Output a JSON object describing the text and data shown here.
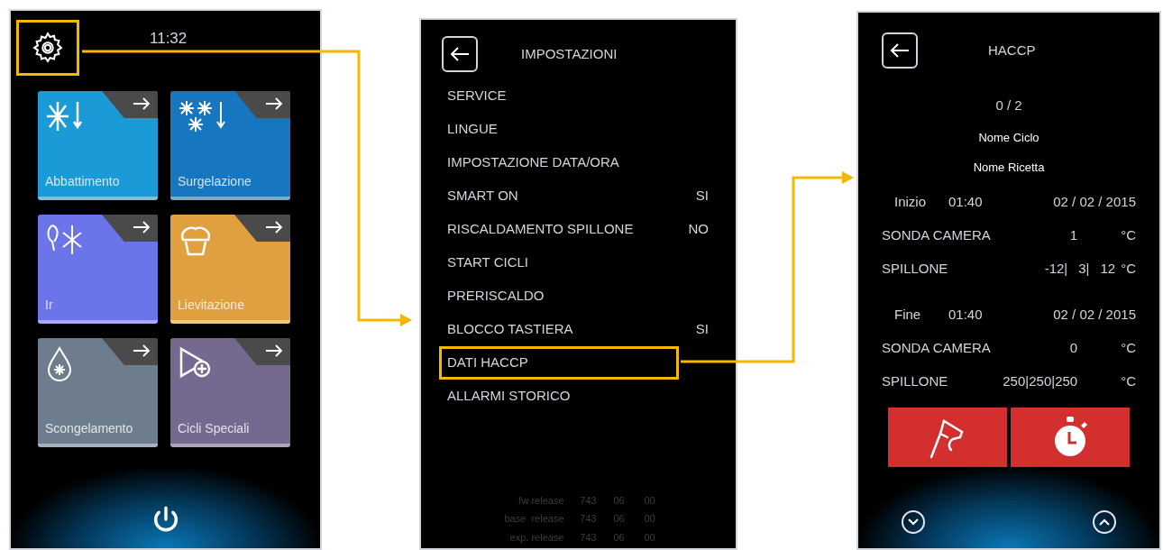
{
  "home": {
    "time": "11:32",
    "tiles": [
      {
        "label": "Abbattimento",
        "kind": "blast",
        "color": "#1a9ad6"
      },
      {
        "label": "Surgelazione",
        "kind": "freeze",
        "color": "#1676c0"
      },
      {
        "label": "Ir",
        "kind": "ir",
        "color": "#6b74e8"
      },
      {
        "label": "Lievitazione",
        "kind": "proof",
        "color": "#e0a040"
      },
      {
        "label": "Scongelamento",
        "kind": "thaw",
        "color": "#6e7d8e"
      },
      {
        "label": "Cicli Speciali",
        "kind": "special",
        "color": "#75698f"
      }
    ]
  },
  "settings": {
    "title": "IMPOSTAZIONI",
    "items": [
      {
        "label": "SERVICE",
        "selected": false
      },
      {
        "label": "LINGUE",
        "selected": false
      },
      {
        "label": "IMPOSTAZIONE DATA/ORA",
        "selected": false
      },
      {
        "label": "SMART ON",
        "value": "SI",
        "selected": false
      },
      {
        "label": "RISCALDAMENTO SPILLONE",
        "value": "NO",
        "selected": false
      },
      {
        "label": "START CICLI",
        "selected": false
      },
      {
        "label": "PRERISCALDO",
        "selected": false
      },
      {
        "label": "BLOCCO TASTIERA",
        "value": "SI",
        "selected": false
      },
      {
        "label": "DATI HACCP",
        "selected": true
      },
      {
        "label": "ALLARMI STORICO",
        "selected": false
      }
    ],
    "releases": [
      {
        "label": "fw release",
        "values": [
          "743",
          "06",
          "00"
        ]
      },
      {
        "label": "base  release",
        "values": [
          "743",
          "06",
          "00"
        ]
      },
      {
        "label": "exp. release",
        "values": [
          "743",
          "06",
          "00"
        ]
      }
    ]
  },
  "haccp": {
    "title": "HACCP",
    "counter": "0 / 2",
    "cycle_name": "Nome Ciclo",
    "recipe_name": "Nome Ricetta",
    "sections": [
      {
        "label": "Inizio",
        "time": "01:40",
        "date": "02 / 02 / 2015",
        "rows": [
          {
            "label": "SONDA CAMERA",
            "readings": [
              "1"
            ],
            "unit": "°C"
          },
          {
            "label": "SPILLONE",
            "readings": [
              "-12|",
              "3|",
              "12"
            ],
            "unit": "°C"
          }
        ]
      },
      {
        "label": "Fine",
        "time": "01:40",
        "date": "02 / 02 / 2015",
        "rows": [
          {
            "label": "SONDA CAMERA",
            "readings": [
              "0"
            ],
            "unit": "°C"
          },
          {
            "label": "SPILLONE",
            "readings": [
              "250|250|250"
            ],
            "unit": "°C"
          }
        ]
      }
    ]
  }
}
